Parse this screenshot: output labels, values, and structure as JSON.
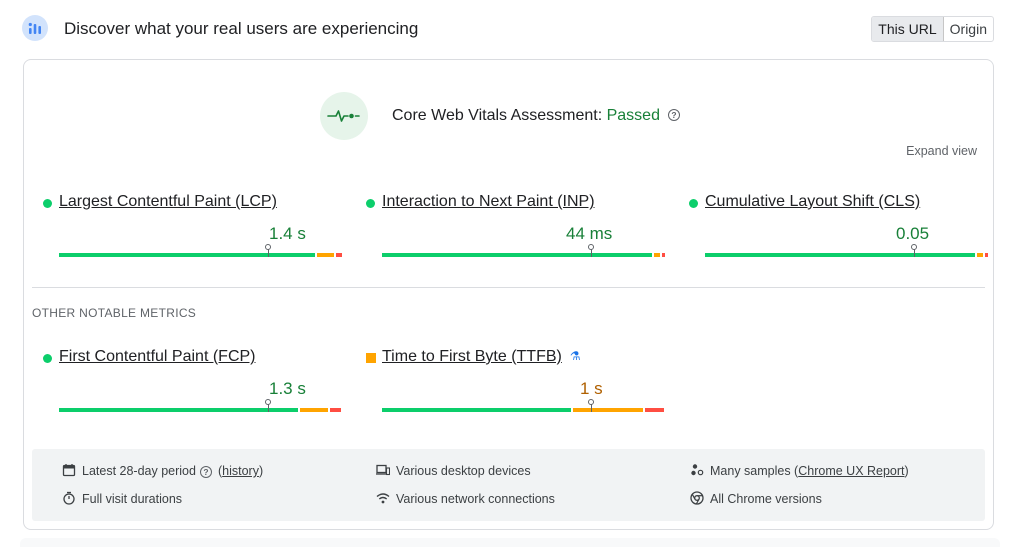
{
  "header": {
    "title": "Discover what your real users are experiencing",
    "toggle": [
      "This URL",
      "Origin"
    ],
    "active_toggle": "This URL"
  },
  "assessment": {
    "label": "Core Web Vitals Assessment: ",
    "status": "Passed",
    "icon": "pulse-icon",
    "help_icon": "help-icon"
  },
  "expand_view": "Expand view",
  "core_metrics": [
    {
      "label": "Largest Contentful Paint (LCP)",
      "value": "1.4 s",
      "rating": "good",
      "distribution": {
        "good": 0.92,
        "needs_improvement": 0.06,
        "poor": 0.02
      }
    },
    {
      "label": "Interaction to Next Paint (INP)",
      "value": "44 ms",
      "rating": "good",
      "distribution": {
        "good": 0.97,
        "needs_improvement": 0.02,
        "poor": 0.01
      }
    },
    {
      "label": "Cumulative Layout Shift (CLS)",
      "value": "0.05",
      "rating": "good",
      "distribution": {
        "good": 0.97,
        "needs_improvement": 0.02,
        "poor": 0.01
      }
    }
  ],
  "other_title": "OTHER NOTABLE METRICS",
  "other_metrics": [
    {
      "label": "First Contentful Paint (FCP)",
      "value": "1.3 s",
      "rating": "good",
      "distribution": {
        "good": 0.86,
        "needs_improvement": 0.1,
        "poor": 0.04
      }
    },
    {
      "label": "Time to First Byte (TTFB)",
      "value": "1 s",
      "rating": "needs-improvement",
      "experimental_icon": "flask-icon",
      "distribution": {
        "good": 0.68,
        "needs_improvement": 0.25,
        "poor": 0.07
      }
    }
  ],
  "info": {
    "period": "Latest 28-day period",
    "history": "history",
    "devices": "Various desktop devices",
    "samples_prefix": "Many samples (",
    "samples_link": "Chrome UX Report",
    "samples_suffix": ")",
    "durations": "Full visit durations",
    "network": "Various network connections",
    "versions": "All Chrome versions"
  },
  "colors": {
    "good": "#0cce6b",
    "needs_improvement": "#ffa400",
    "poor": "#ff4e42",
    "good_text": "#188038",
    "avg_text": "#b06000"
  }
}
